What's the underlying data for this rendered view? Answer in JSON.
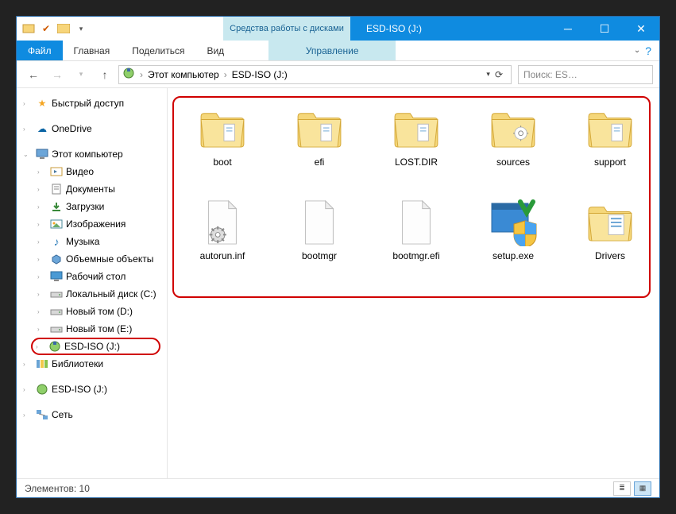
{
  "titlebar": {
    "tooltab_title": "Средства работы с дисками",
    "window_title": "ESD-ISO (J:)"
  },
  "ribbon": {
    "file": "Файл",
    "tabs": [
      "Главная",
      "Поделиться",
      "Вид"
    ],
    "tooltab": "Управление"
  },
  "navbar": {
    "crumbs": [
      "Этот компьютер",
      "ESD-ISO (J:)"
    ],
    "search_placeholder": "Поиск: ES…"
  },
  "sidebar": {
    "quick_access": "Быстрый доступ",
    "onedrive": "OneDrive",
    "this_pc": "Этот компьютер",
    "this_pc_children": [
      {
        "label": "Видео",
        "icon": "video"
      },
      {
        "label": "Документы",
        "icon": "documents"
      },
      {
        "label": "Загрузки",
        "icon": "downloads"
      },
      {
        "label": "Изображения",
        "icon": "pictures"
      },
      {
        "label": "Музыка",
        "icon": "music"
      },
      {
        "label": "Объемные объекты",
        "icon": "3d"
      },
      {
        "label": "Рабочий стол",
        "icon": "desktop"
      },
      {
        "label": "Локальный диск (C:)",
        "icon": "drive"
      },
      {
        "label": "Новый том (D:)",
        "icon": "drive"
      },
      {
        "label": "Новый том (E:)",
        "icon": "drive"
      },
      {
        "label": "ESD-ISO (J:)",
        "icon": "disc",
        "highlight": true
      }
    ],
    "libraries": "Библиотеки",
    "disc_dup": "ESD-ISO (J:)",
    "network": "Сеть"
  },
  "files": [
    {
      "name": "boot",
      "type": "folder"
    },
    {
      "name": "efi",
      "type": "folder"
    },
    {
      "name": "LOST.DIR",
      "type": "folder"
    },
    {
      "name": "sources",
      "type": "folder-gear"
    },
    {
      "name": "support",
      "type": "folder"
    },
    {
      "name": "autorun.inf",
      "type": "file-gear"
    },
    {
      "name": "bootmgr",
      "type": "file"
    },
    {
      "name": "bootmgr.efi",
      "type": "file"
    },
    {
      "name": "setup.exe",
      "type": "exe-shield"
    },
    {
      "name": "Drivers",
      "type": "folder-doc"
    }
  ],
  "statusbar": {
    "count_label": "Элементов: 10"
  }
}
